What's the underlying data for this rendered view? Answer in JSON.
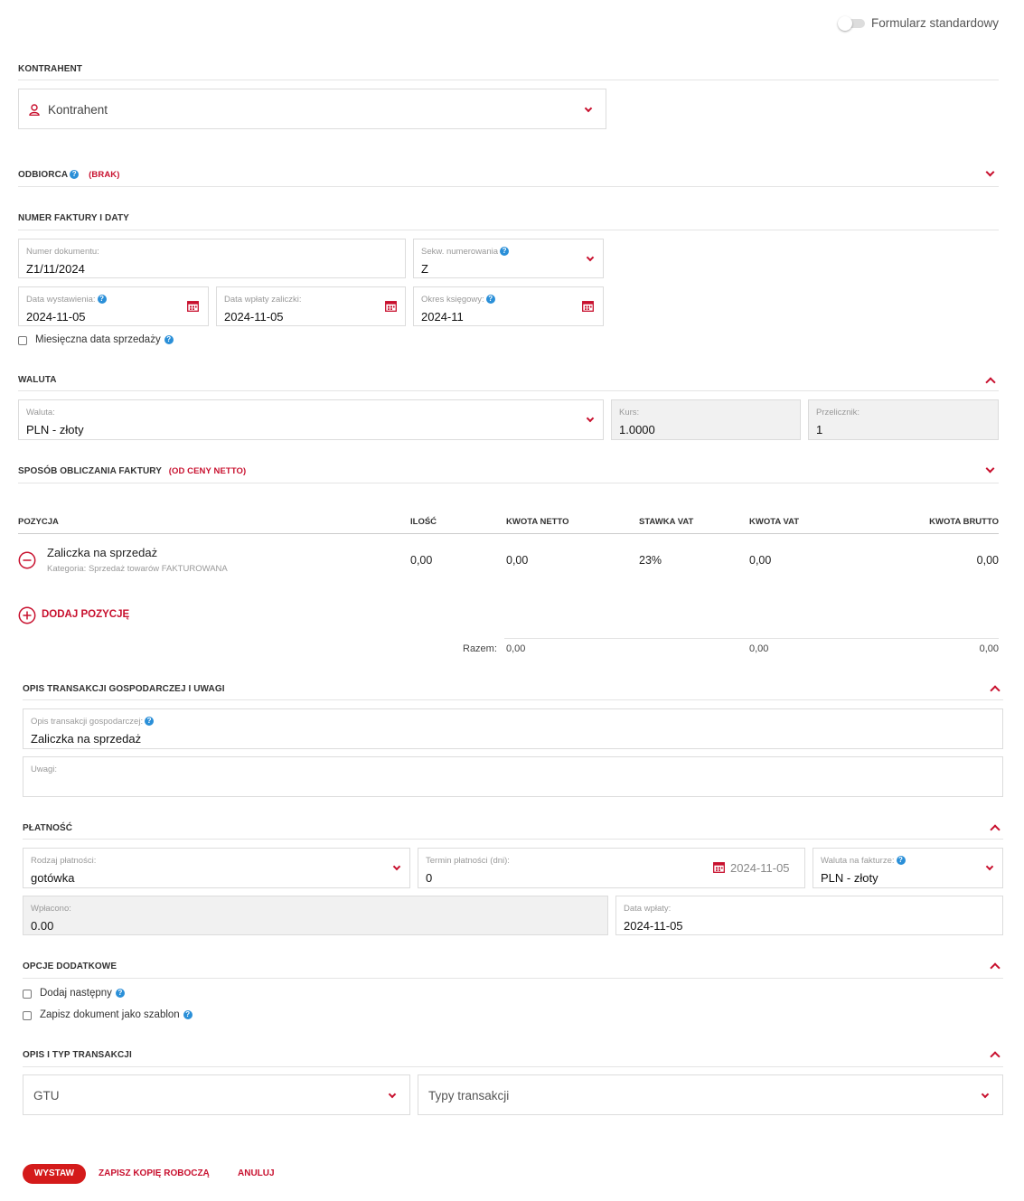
{
  "toggle": {
    "label": "Formularz standardowy",
    "on": false
  },
  "kontrahent": {
    "section": "KONTRAHENT",
    "placeholder": "Kontrahent"
  },
  "odbiorca": {
    "section": "ODBIORCA",
    "tag": "(BRAK)"
  },
  "numer": {
    "section": "NUMER FAKTURY I DATY",
    "doc_label": "Numer dokumentu:",
    "doc_value": "Z1/11/2024",
    "seq_label": "Sekw. numerowania",
    "seq_value": "Z",
    "issue_label": "Data wystawienia:",
    "issue_value": "2024-11-05",
    "paydate_label": "Data wpłaty zaliczki:",
    "paydate_value": "2024-11-05",
    "period_label": "Okres księgowy:",
    "period_value": "2024-11",
    "monthly_label": "Miesięczna data sprzedaży"
  },
  "waluta": {
    "section": "WALUTA",
    "currency_label": "Waluta:",
    "currency_value": "PLN - złoty",
    "rate_label": "Kurs:",
    "rate_value": "1.0000",
    "conv_label": "Przelicznik:",
    "conv_value": "1"
  },
  "sposob": {
    "section": "SPOSÓB OBLICZANIA FAKTURY",
    "tag": "(OD CENY NETTO)"
  },
  "table": {
    "headers": [
      "POZYCJA",
      "ILOŚĆ",
      "KWOTA NETTO",
      "STAWKA VAT",
      "KWOTA VAT",
      "KWOTA BRUTTO"
    ],
    "row": {
      "name": "Zaliczka na sprzedaż",
      "category": "Kategoria: Sprzedaż towarów FAKTUROWANA",
      "qty": "0,00",
      "net": "0,00",
      "vat_rate": "23%",
      "vat": "0,00",
      "gross": "0,00"
    },
    "add_label": "DODAJ POZYCJĘ",
    "total_label": "Razem:",
    "total_net": "0,00",
    "total_vat": "0,00",
    "total_gross": "0,00"
  },
  "opis": {
    "section": "OPIS TRANSAKCJI GOSPODARCZEJ I UWAGI",
    "desc_label": "Opis transakcji gospodarczej:",
    "desc_value": "Zaliczka na sprzedaż",
    "notes_label": "Uwagi:"
  },
  "platnosc": {
    "section": "PŁATNOŚĆ",
    "type_label": "Rodzaj płatności:",
    "type_value": "gotówka",
    "term_label": "Termin płatności (dni):",
    "term_value": "0",
    "term_date": "2024-11-05",
    "cur_label": "Waluta na fakturze:",
    "cur_value": "PLN - złoty",
    "paid_label": "Wpłacono:",
    "paid_value": "0.00",
    "paid_date_label": "Data wpłaty:",
    "paid_date_value": "2024-11-05"
  },
  "opcje": {
    "section": "OPCJE DODATKOWE",
    "next_label": "Dodaj następny",
    "template_label": "Zapisz dokument jako szablon"
  },
  "transakcja": {
    "section": "OPIS I TYP TRANSAKCJI",
    "gtu_placeholder": "GTU",
    "types_placeholder": "Typy transakcji"
  },
  "actions": {
    "issue": "WYSTAW",
    "draft": "ZAPISZ KOPIĘ ROBOCZĄ",
    "cancel": "ANULUJ"
  },
  "colors": {
    "accent": "#c8102e",
    "button": "#d41b1b",
    "help": "#2a8fd8"
  }
}
